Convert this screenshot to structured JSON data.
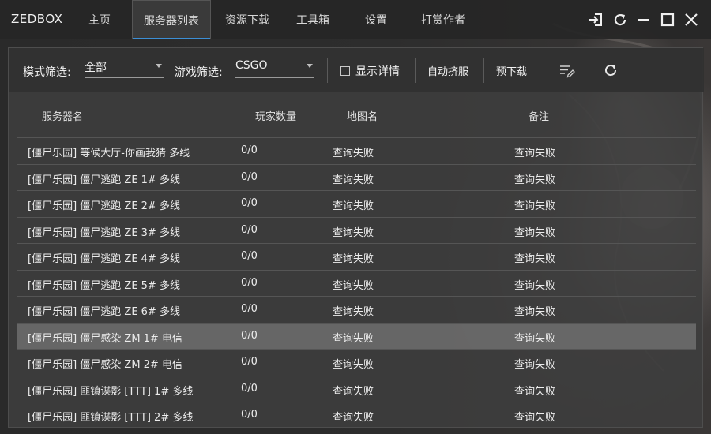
{
  "app": {
    "title": "ZEDBOX"
  },
  "tabs": [
    {
      "label": "主页"
    },
    {
      "label": "服务器列表"
    },
    {
      "label": "资源下载"
    },
    {
      "label": "工具箱"
    },
    {
      "label": "设置"
    },
    {
      "label": "打赏作者"
    }
  ],
  "active_tab": "服务器列表",
  "window_controls": [
    "login-icon",
    "refresh-icon",
    "minimize-icon",
    "maximize-icon",
    "close-icon"
  ],
  "toolbar": {
    "mode_label": "模式筛选:",
    "mode_value": "全部",
    "game_label": "游戏筛选:",
    "game_value": "CSGO",
    "show_details_label": "显示详情",
    "show_details_checked": false,
    "auto_join_label": "自动挤服",
    "predownload_label": "预下载",
    "edit_icon": "list-edit-icon",
    "refresh_icon": "refresh-icon"
  },
  "table": {
    "headers": {
      "name": "服务器名",
      "players": "玩家数量",
      "map": "地图名",
      "note": "备注"
    },
    "rows": [
      {
        "name": "[僵尸乐园] 等候大厅-你画我猜 多线",
        "players": "0/0",
        "map": "查询失败",
        "note": "查询失败"
      },
      {
        "name": "[僵尸乐园] 僵尸逃跑 ZE 1# 多线",
        "players": "0/0",
        "map": "查询失败",
        "note": "查询失败"
      },
      {
        "name": "[僵尸乐园] 僵尸逃跑 ZE 2# 多线",
        "players": "0/0",
        "map": "查询失败",
        "note": "查询失败"
      },
      {
        "name": "[僵尸乐园] 僵尸逃跑 ZE 3# 多线",
        "players": "0/0",
        "map": "查询失败",
        "note": "查询失败"
      },
      {
        "name": "[僵尸乐园] 僵尸逃跑 ZE 4# 多线",
        "players": "0/0",
        "map": "查询失败",
        "note": "查询失败"
      },
      {
        "name": "[僵尸乐园] 僵尸逃跑 ZE 5# 多线",
        "players": "0/0",
        "map": "查询失败",
        "note": "查询失败"
      },
      {
        "name": "[僵尸乐园] 僵尸逃跑 ZE 6# 多线",
        "players": "0/0",
        "map": "查询失败",
        "note": "查询失败"
      },
      {
        "name": "[僵尸乐园] 僵尸感染 ZM 1# 电信",
        "players": "0/0",
        "map": "查询失败",
        "note": "查询失败"
      },
      {
        "name": "[僵尸乐园] 僵尸感染 ZM 2# 电信",
        "players": "0/0",
        "map": "查询失败",
        "note": "查询失败"
      },
      {
        "name": "[僵尸乐园] 匪镇谍影 [TTT] 1# 多线",
        "players": "0/0",
        "map": "查询失败",
        "note": "查询失败"
      },
      {
        "name": "[僵尸乐园] 匪镇谍影 [TTT] 2# 多线",
        "players": "0/0",
        "map": "查询失败",
        "note": "查询失败"
      }
    ],
    "selected_row": 7
  }
}
